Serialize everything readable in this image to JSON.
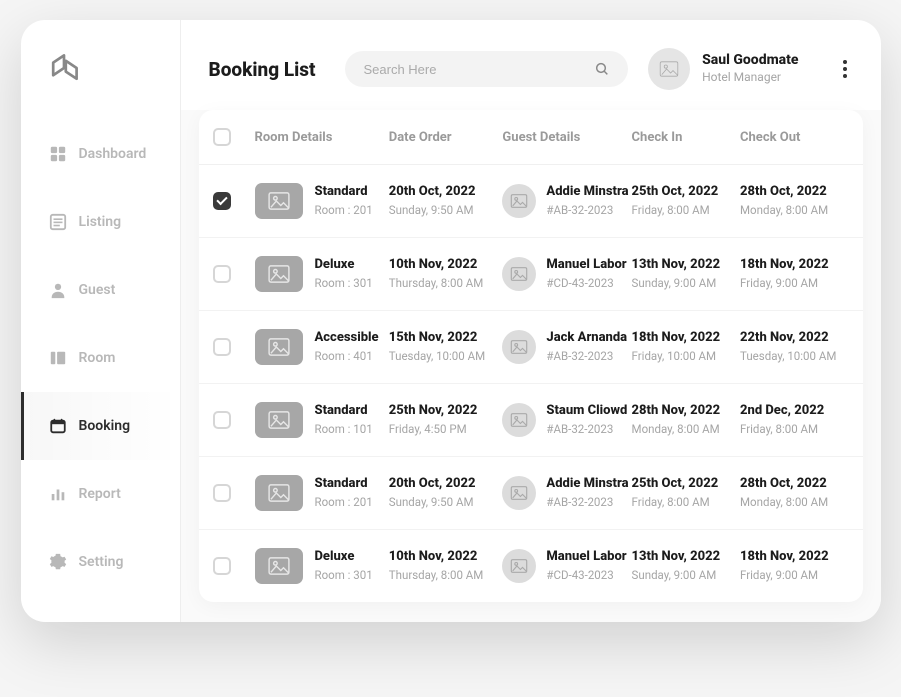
{
  "header": {
    "title": "Booking List",
    "search_placeholder": "Search Here",
    "user_name": "Saul Goodmate",
    "user_role": "Hotel Manager"
  },
  "sidebar": {
    "items": [
      {
        "key": "dashboard",
        "label": "Dashboard",
        "icon": "grid-icon"
      },
      {
        "key": "listing",
        "label": "Listing",
        "icon": "list-icon"
      },
      {
        "key": "guest",
        "label": "Guest",
        "icon": "user-icon"
      },
      {
        "key": "room",
        "label": "Room",
        "icon": "panels-icon"
      },
      {
        "key": "booking",
        "label": "Booking",
        "icon": "calendar-icon",
        "active": true
      },
      {
        "key": "report",
        "label": "Report",
        "icon": "bars-icon"
      },
      {
        "key": "setting",
        "label": "Setting",
        "icon": "gear-icon"
      }
    ]
  },
  "table": {
    "columns": {
      "room": "Room Details",
      "date": "Date Order",
      "guest": "Guest Details",
      "checkin": "Check In",
      "checkout": "Check Out"
    },
    "rows": [
      {
        "checked": true,
        "room_type": "Standard",
        "room_sub": "Room : 201",
        "date": "20th Oct, 2022",
        "date_sub": "Sunday, 9:50 AM",
        "guest": "Addie Minstra",
        "guest_sub": "#AB-32-2023",
        "checkin": "25th Oct, 2022",
        "checkin_sub": "Friday, 8:00 AM",
        "checkout": "28th Oct, 2022",
        "checkout_sub": "Monday, 8:00 AM"
      },
      {
        "checked": false,
        "room_type": "Deluxe",
        "room_sub": "Room : 301",
        "date": "10th Nov, 2022",
        "date_sub": "Thursday, 8:00 AM",
        "guest": "Manuel Labor",
        "guest_sub": "#CD-43-2023",
        "checkin": "13th Nov, 2022",
        "checkin_sub": "Sunday, 9:00 AM",
        "checkout": "18th Nov, 2022",
        "checkout_sub": "Friday, 9:00 AM"
      },
      {
        "checked": false,
        "room_type": "Accessible",
        "room_sub": "Room : 401",
        "date": "15th Nov, 2022",
        "date_sub": "Tuesday, 10:00 AM",
        "guest": "Jack Arnanda",
        "guest_sub": "#AB-32-2023",
        "checkin": "18th Nov, 2022",
        "checkin_sub": "Friday, 10:00 AM",
        "checkout": "22th Nov, 2022",
        "checkout_sub": "Tuesday, 10:00 AM"
      },
      {
        "checked": false,
        "room_type": "Standard",
        "room_sub": "Room : 101",
        "date": "25th Nov, 2022",
        "date_sub": "Friday, 4:50 PM",
        "guest": "Staum Cliowd",
        "guest_sub": "#AB-32-2023",
        "checkin": "28th Nov, 2022",
        "checkin_sub": "Monday, 8:00 AM",
        "checkout": "2nd Dec, 2022",
        "checkout_sub": "Friday, 8:00 AM"
      },
      {
        "checked": false,
        "room_type": "Standard",
        "room_sub": "Room : 201",
        "date": "20th Oct, 2022",
        "date_sub": "Sunday, 9:50 AM",
        "guest": "Addie Minstra",
        "guest_sub": "#AB-32-2023",
        "checkin": "25th Oct, 2022",
        "checkin_sub": "Friday, 8:00 AM",
        "checkout": "28th Oct, 2022",
        "checkout_sub": "Monday, 8:00 AM"
      },
      {
        "checked": false,
        "room_type": "Deluxe",
        "room_sub": "Room : 301",
        "date": "10th Nov, 2022",
        "date_sub": "Thursday, 8:00 AM",
        "guest": "Manuel Labor",
        "guest_sub": "#CD-43-2023",
        "checkin": "13th Nov, 2022",
        "checkin_sub": "Sunday, 9:00 AM",
        "checkout": "18th Nov, 2022",
        "checkout_sub": "Friday, 9:00 AM"
      }
    ]
  }
}
